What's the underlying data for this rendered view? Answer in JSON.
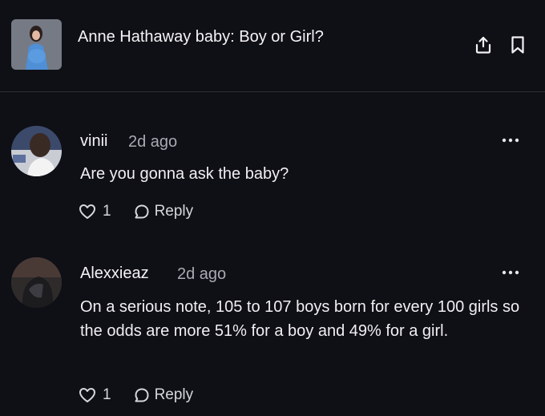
{
  "post": {
    "title": "Anne Hathaway baby: Boy or Girl?",
    "thumbnail_icon": "photo-thumbnail"
  },
  "header": {
    "share_icon": "share-icon",
    "bookmark_icon": "bookmark-icon"
  },
  "comments": [
    {
      "username": "vinii",
      "time": "2d ago",
      "text": "Are you gonna ask the baby?",
      "likes": "1",
      "reply_label": "Reply"
    },
    {
      "username": "Alexxieaz",
      "time": "2d ago",
      "text": "On a serious note, 105 to 107 boys born for every 100 girls so the odds are more 51% for a boy and 49% for a girl.",
      "likes": "1",
      "reply_label": "Reply"
    }
  ],
  "colors": {
    "background": "#0f0f16",
    "text": "#f2f2f4",
    "muted": "#a9aab2",
    "divider": "#2e2f36"
  }
}
